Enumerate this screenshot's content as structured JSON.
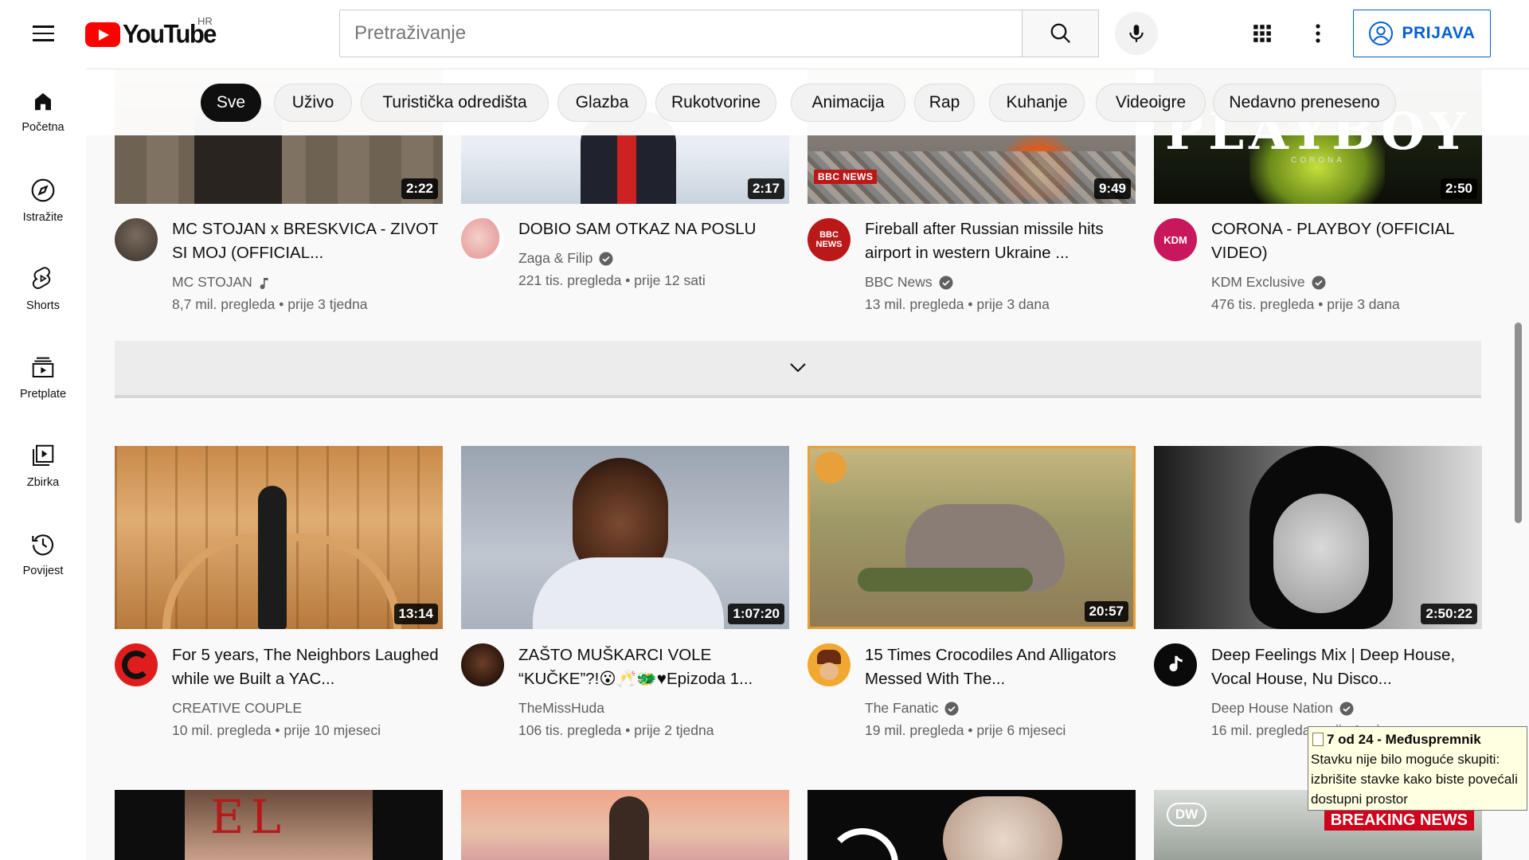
{
  "header": {
    "logo_text": "YouTube",
    "country": "HR",
    "search_placeholder": "Pretraživanje",
    "signin_label": "PRIJAVA"
  },
  "sidebar": {
    "items": [
      {
        "label": "Početna",
        "icon": "home-icon"
      },
      {
        "label": "Istražite",
        "icon": "compass-icon"
      },
      {
        "label": "Shorts",
        "icon": "shorts-icon"
      },
      {
        "label": "Pretplate",
        "icon": "subscriptions-icon"
      },
      {
        "label": "Zbirka",
        "icon": "library-icon"
      },
      {
        "label": "Povijest",
        "icon": "history-icon"
      }
    ]
  },
  "chips": [
    "Sve",
    "Uživo",
    "Turistička odredišta",
    "Glazba",
    "Rukotvorine",
    "Animacija",
    "Rap",
    "Kuhanje",
    "Videoigre",
    "Nedavno preneseno"
  ],
  "row1": [
    {
      "title": "MC STOJAN x BRESKVICA - ZIVOT SI MOJ (OFFICIAL...",
      "channel": "MC STOJAN",
      "badge": "music-note-icon",
      "views": "8,7 mil. pregleda",
      "age": "prije 3 tjedna",
      "duration": "2:22"
    },
    {
      "title": "DOBIO SAM OTKAZ NA POSLU",
      "channel": "Zaga & Filip",
      "badge": "verified-icon",
      "views": "221 tis. pregleda",
      "age": "prije 12 sati",
      "duration": "2:17"
    },
    {
      "title": "Fireball after Russian missile hits airport in western Ukraine ...",
      "channel": "BBC News",
      "badge": "verified-icon",
      "views": "13 mil. pregleda",
      "age": "prije 3 dana",
      "duration": "9:49",
      "thumb_text": "BBC NEWS",
      "avatar_text": "BBC NEWS"
    },
    {
      "title": "CORONA - PLAYBOY (OFFICIAL VIDEO)",
      "channel": "KDM Exclusive",
      "badge": "verified-icon",
      "views": "476 tis. pregleda",
      "age": "prije 3 dana",
      "duration": "2:50",
      "thumb_text": "PLAYBOY",
      "thumb_sub": "CORONA",
      "avatar_text": "KDM"
    }
  ],
  "row2": [
    {
      "title": "For 5 years, The Neighbors Laughed while we Built a YAC...",
      "channel": "CREATIVE COUPLE",
      "badge": "",
      "views": "10 mil. pregleda",
      "age": "prije 10 mjeseci",
      "duration": "13:14"
    },
    {
      "title": "ZAŠTO MUŠKARCI VOLE “KUČKE”?!😮🥂🐲♥Epizoda 1...",
      "channel": "TheMissHuda",
      "badge": "",
      "views": "106 tis. pregleda",
      "age": "prije 2 tjedna",
      "duration": "1:07:20"
    },
    {
      "title": "15 Times Crocodiles And Alligators Messed With The...",
      "channel": "The Fanatic",
      "badge": "verified-icon",
      "views": "19 mil. pregleda",
      "age": "prije 6 mjeseci",
      "duration": "20:57"
    },
    {
      "title": "Deep Feelings Mix | Deep House, Vocal House, Nu Disco...",
      "channel": "Deep House Nation",
      "badge": "verified-icon",
      "views": "16 mil. pregleda",
      "age": "prije 1 mjesec",
      "duration": "2:50:22"
    }
  ],
  "row3": [
    {
      "thumb_text": "EL"
    },
    {
      "thumb_text": ""
    },
    {
      "thumb_text": ""
    },
    {
      "thumb_text": "BREAKING NEWS",
      "logo_text": "DW"
    }
  ],
  "tooltip": {
    "title": "7 od 24 - Međuspremnik",
    "lines": [
      "Stavku nije bilo moguće skupiti:",
      "izbrišite stavke kako biste povećali",
      "dostupni prostor"
    ]
  },
  "colors": {
    "accent": "#065fd4",
    "brand_red": "#ff0000",
    "active_chip": "#0f0f0f"
  }
}
